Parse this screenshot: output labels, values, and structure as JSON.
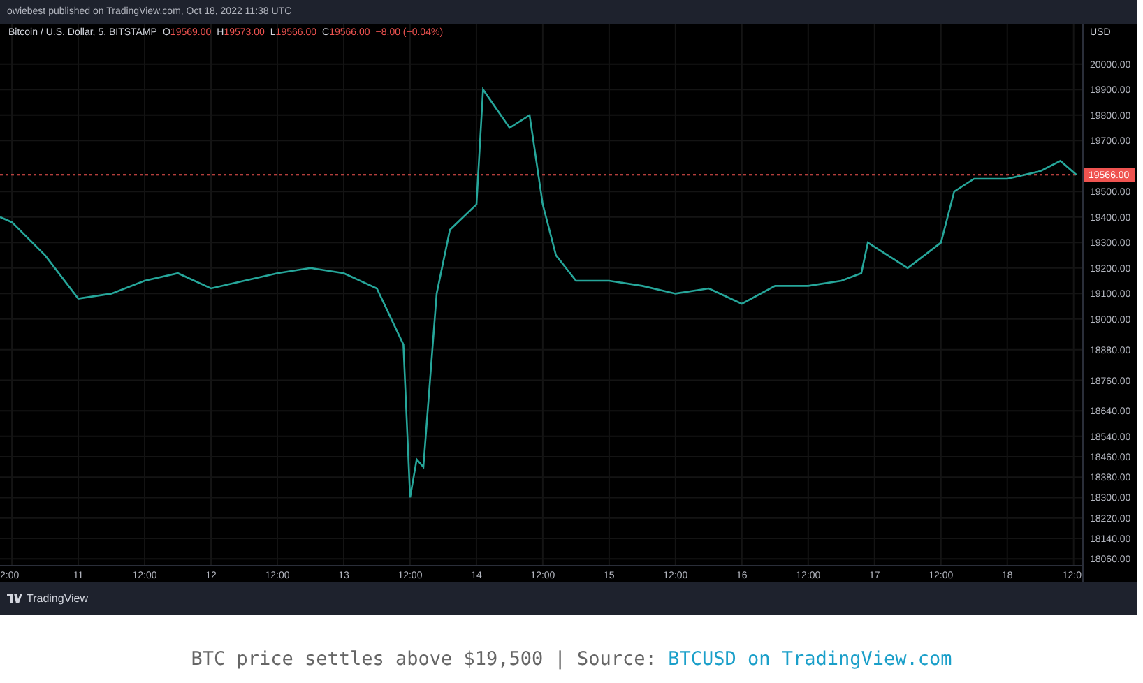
{
  "header": {
    "published": "owiebest published on TradingView.com, Oct 18, 2022 11:38 UTC"
  },
  "chart": {
    "legend": {
      "symbol": "Bitcoin / U.S. Dollar, 5, BITSTAMP",
      "ohlc": [
        {
          "key": "O",
          "value": "19569.00"
        },
        {
          "key": "H",
          "value": "19573.00"
        },
        {
          "key": "L",
          "value": "19566.00"
        },
        {
          "key": "C",
          "value": "19566.00"
        }
      ],
      "change": "−8.00 (−0.04%)"
    },
    "currency": "USD",
    "last_price": "19566.00",
    "chart_data": {
      "type": "line",
      "xlim": [
        10.41,
        18.57
      ],
      "ylim": [
        18033,
        20158
      ],
      "x": [
        10.41,
        10.5,
        10.75,
        11.0,
        11.25,
        11.5,
        11.75,
        12.0,
        12.25,
        12.5,
        12.75,
        13.0,
        13.25,
        13.45,
        13.5,
        13.55,
        13.6,
        13.7,
        13.8,
        14.0,
        14.05,
        14.25,
        14.4,
        14.5,
        14.6,
        14.75,
        15.0,
        15.25,
        15.5,
        15.75,
        16.0,
        16.25,
        16.5,
        16.75,
        16.9,
        16.95,
        17.1,
        17.25,
        17.5,
        17.6,
        17.75,
        18.0,
        18.25,
        18.4,
        18.52
      ],
      "grid": true,
      "series": [
        {
          "color": "#26a69a",
          "values": [
            19400,
            19380,
            19250,
            19080,
            19100,
            19150,
            19180,
            19120,
            19150,
            19180,
            19200,
            19180,
            19120,
            18900,
            18300,
            18450,
            18420,
            19100,
            19350,
            19450,
            19900,
            19750,
            19800,
            19450,
            19250,
            19150,
            19150,
            19130,
            19100,
            19120,
            19060,
            19130,
            19130,
            19150,
            19180,
            19300,
            19250,
            19200,
            19300,
            19500,
            19550,
            19550,
            19580,
            19620,
            19566
          ]
        },
        {
          "color": "#ef5350",
          "line_style": "dashed",
          "values": [
            19566,
            19566,
            19566,
            19566,
            19566,
            19566,
            19566,
            19566,
            19566,
            19566,
            19566,
            19566,
            19566,
            19566,
            19566,
            19566,
            19566,
            19566,
            19566,
            19566,
            19566,
            19566,
            19566,
            19566,
            19566,
            19566,
            19566,
            19566,
            19566,
            19566,
            19566,
            19566,
            19566,
            19566,
            19566,
            19566,
            19566,
            19566,
            19566,
            19566,
            19566,
            19566,
            19566,
            19566,
            19566
          ]
        }
      ],
      "yticks": [
        {
          "value": 20000,
          "label": "20000.00"
        },
        {
          "value": 19900,
          "label": "19900.00"
        },
        {
          "value": 19800,
          "label": "19800.00"
        },
        {
          "value": 19700,
          "label": "19700.00"
        },
        {
          "value": 19500,
          "label": "19500.00"
        },
        {
          "value": 19400,
          "label": "19400.00"
        },
        {
          "value": 19300,
          "label": "19300.00"
        },
        {
          "value": 19200,
          "label": "19200.00"
        },
        {
          "value": 19100,
          "label": "19100.00"
        },
        {
          "value": 19000,
          "label": "19000.00"
        },
        {
          "value": 18880,
          "label": "18880.00"
        },
        {
          "value": 18760,
          "label": "18760.00"
        },
        {
          "value": 18640,
          "label": "18640.00"
        },
        {
          "value": 18540,
          "label": "18540.00"
        },
        {
          "value": 18460,
          "label": "18460.00"
        },
        {
          "value": 18380,
          "label": "18380.00"
        },
        {
          "value": 18300,
          "label": "18300.00"
        },
        {
          "value": 18220,
          "label": "18220.00"
        },
        {
          "value": 18140,
          "label": "18140.00"
        },
        {
          "value": 18060,
          "label": "18060.00"
        }
      ],
      "xticks": [
        11,
        12,
        13,
        14,
        15,
        16,
        17,
        18
      ]
    },
    "midday_labels": [
      "2:00",
      "12:00",
      "12:00",
      "12:00",
      "12:00",
      "12:00",
      "12:00",
      "12:00",
      "12:0"
    ]
  },
  "footer": {
    "brand": "TradingView"
  },
  "caption": {
    "text": "BTC price settles above $19,500 | Source: ",
    "link": "BTCUSD on TradingView.com"
  }
}
